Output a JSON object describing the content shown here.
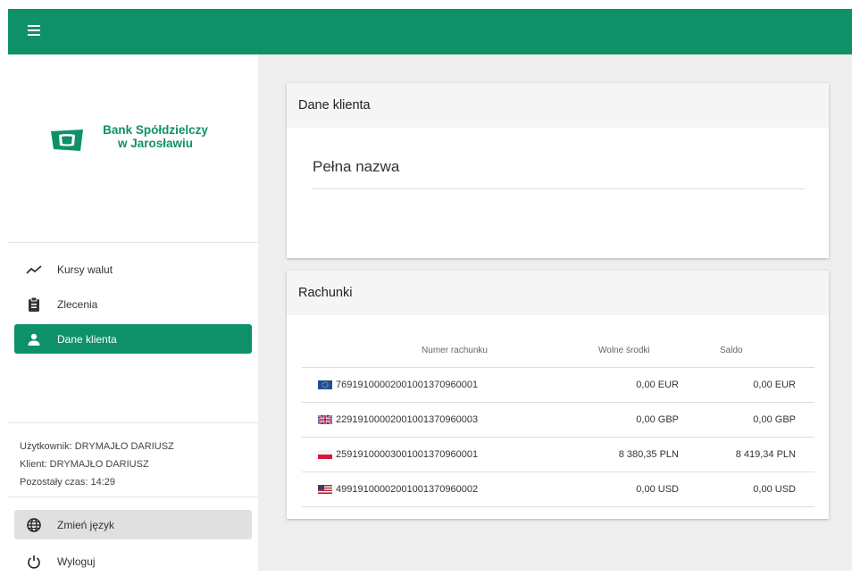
{
  "topbar": {
    "menu_icon": "hamburger-icon",
    "color": "#0e9168"
  },
  "logo": {
    "line1": "Bank Spółdzielczy",
    "line2": "w Jarosławiu"
  },
  "nav": [
    {
      "label": "Kursy walut",
      "icon": "trend-icon",
      "active": false
    },
    {
      "label": "Zlecenia",
      "icon": "clipboard-icon",
      "active": false
    },
    {
      "label": "Dane klienta",
      "icon": "person-icon",
      "active": true
    }
  ],
  "user_info": {
    "user": "Użytkownik: DRYMAJŁO DARIUSZ",
    "client": "Klient: DRYMAJŁO DARIUSZ",
    "time": "Pozostały czas: 14:29"
  },
  "actions": {
    "language": "Zmień język",
    "logout": "Wyloguj"
  },
  "client_card": {
    "title": "Dane klienta",
    "field_label": "Pełna nazwa"
  },
  "accounts_card": {
    "title": "Rachunki",
    "headers": {
      "number": "Numer rachunku",
      "available": "Wolne środki",
      "balance": "Saldo"
    },
    "rows": [
      {
        "flag": "eu",
        "number": "76919100002001001370960001",
        "available": "0,00 EUR",
        "balance": "0,00 EUR"
      },
      {
        "flag": "gb",
        "number": "22919100002001001370960003",
        "available": "0,00 GBP",
        "balance": "0,00 GBP"
      },
      {
        "flag": "pl",
        "number": "25919100003001001370960001",
        "available": "8 380,35 PLN",
        "balance": "8 419,34 PLN"
      },
      {
        "flag": "us",
        "number": "49919100002001001370960002",
        "available": "0,00 USD",
        "balance": "0,00 USD"
      }
    ]
  }
}
